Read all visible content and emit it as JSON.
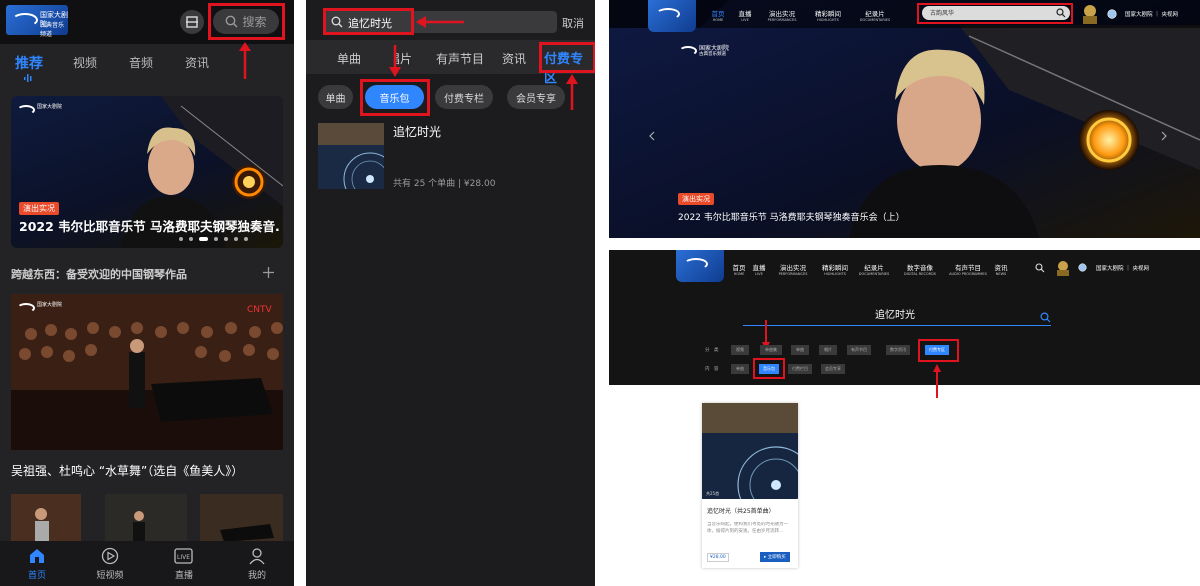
{
  "mobile_home": {
    "logo_line1": "国家大剧院",
    "logo_line2": "古典音乐频道",
    "search_label": "搜索",
    "tabs": [
      "推荐",
      "视频",
      "音频",
      "资讯"
    ],
    "banner_tag": "演出实况",
    "banner_title": "2022 韦尔比耶音乐节 马洛费耶夫钢琴独奏音...",
    "section_title": "跨越东西：备受欢迎的中国钢琴作品",
    "section2_title": "吴祖强、杜鸣心 “水草舞”（选自《鱼美人》）",
    "tabbar": [
      {
        "label": "首页",
        "icon": "home-icon"
      },
      {
        "label": "短视频",
        "icon": "play-circle-icon"
      },
      {
        "label": "直播",
        "icon": "live-icon"
      },
      {
        "label": "我的",
        "icon": "user-icon"
      }
    ],
    "accent": "#2f86ff"
  },
  "mobile_search": {
    "query": "追忆时光",
    "cancel_label": "取消",
    "category_tabs": [
      "单曲",
      "唱片",
      "有声节目",
      "资讯",
      "付费专区"
    ],
    "chips": [
      "单曲",
      "音乐包",
      "付费专栏",
      "会员专享"
    ],
    "result_title": "追忆时光",
    "result_meta": "共有 25 个单曲 | ¥28.00"
  },
  "web_home": {
    "logo_line1": "国家大剧院",
    "logo_line2": "古典音乐频道",
    "nav": [
      {
        "zh": "首页",
        "en": "HOME"
      },
      {
        "zh": "直播",
        "en": "LIVE"
      },
      {
        "zh": "演出实况",
        "en": "PERFORMANCES"
      },
      {
        "zh": "精彩瞬间",
        "en": "HIGHLIGHTS"
      },
      {
        "zh": "纪录片",
        "en": "DOCUMENTARIES"
      }
    ],
    "search_placeholder": "古韵风华",
    "org_links": "国家大剧院 ｜ 央视网",
    "banner_tag": "演出实况",
    "banner_title": "2022 韦尔比耶音乐节 马洛费耶夫钢琴独奏音乐会（上）"
  },
  "web_search": {
    "nav": [
      {
        "zh": "首页",
        "en": "HOME"
      },
      {
        "zh": "直播",
        "en": "LIVE"
      },
      {
        "zh": "演出实况",
        "en": "PERFORMANCES"
      },
      {
        "zh": "精彩瞬间",
        "en": "HIGHLIGHTS"
      },
      {
        "zh": "纪录片",
        "en": "DOCUMENTARIES"
      },
      {
        "zh": "数字音像",
        "en": "DIGITAL RECORDS"
      },
      {
        "zh": "有声节目",
        "en": "AUDIO PROGRAMMES"
      },
      {
        "zh": "资讯",
        "en": "NEWS"
      }
    ],
    "org_links": "国家大剧院 ｜ 央视网",
    "query": "追忆时光",
    "row1_label": "分　类",
    "row1": [
      "视频",
      "单曲集",
      "单曲",
      "唱片",
      "有声节目",
      "数字资讯",
      "付费专区"
    ],
    "row2_label": "内　容",
    "row2": [
      "单曲",
      "音乐包",
      "付费栏目",
      "会员专享"
    ],
    "card_badge": "共25首",
    "card_title": "追忆时光（共25首单曲）",
    "card_desc": "当音乐响起，便和我们寻觅的时光融为一体，偷得片刻的安逸，任由岁月流转...",
    "card_price": "¥28.00",
    "card_button": "▸ 立即购买"
  }
}
